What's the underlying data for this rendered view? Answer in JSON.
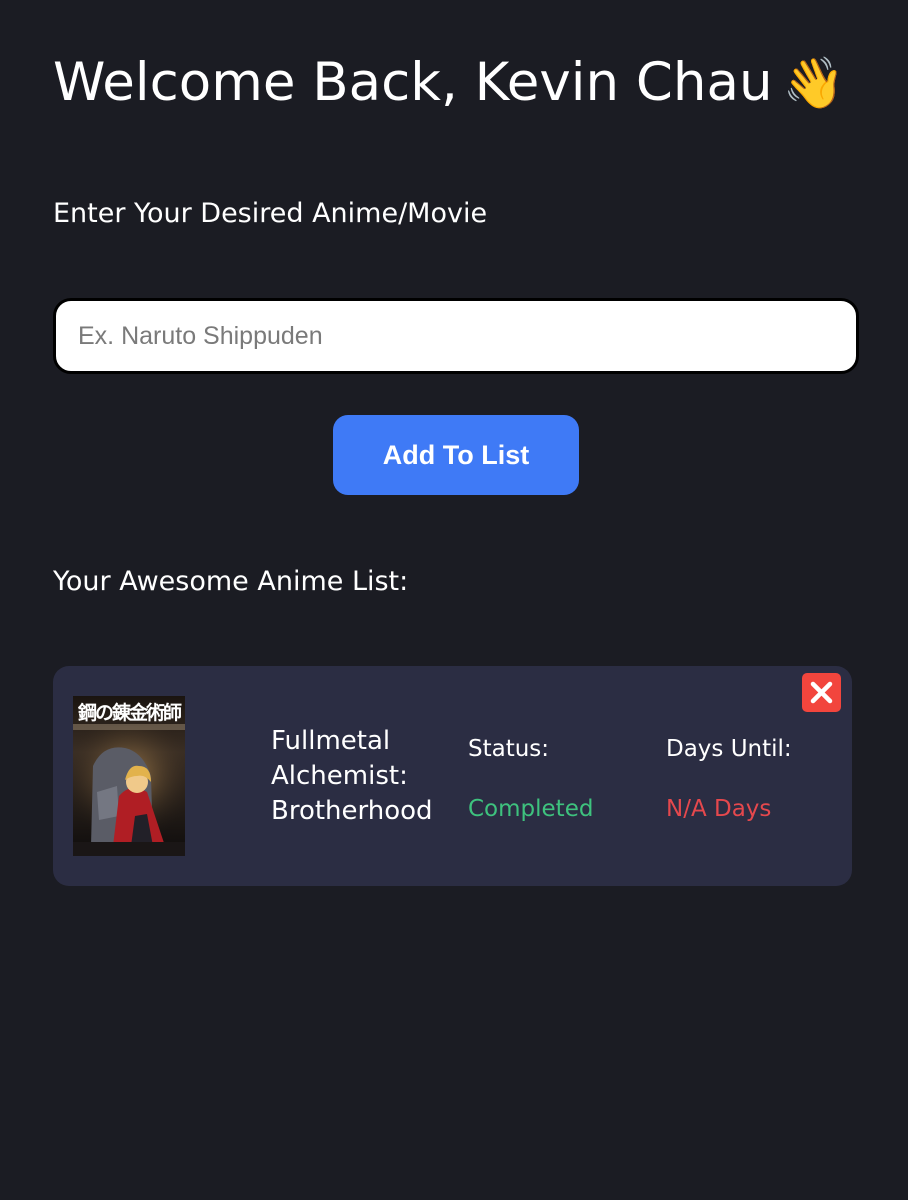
{
  "header": {
    "welcome_text": "Welcome Back, Kevin Chau",
    "wave_emoji": "👋"
  },
  "form": {
    "prompt_label": "Enter Your Desired Anime/Movie",
    "search_placeholder": "Ex. Naruto Shippuden",
    "search_value": "",
    "add_button_label": "Add To List"
  },
  "list": {
    "heading": "Your Awesome Anime List:",
    "items": [
      {
        "poster_text": "鋼の錬金術師",
        "title": "Fullmetal Alchemist: Brotherhood",
        "status_label": "Status:",
        "status_value": "Completed",
        "days_label": "Days Until:",
        "days_value": "N/A Days",
        "delete_icon": "close-x-icon"
      }
    ]
  },
  "colors": {
    "background": "#1b1c23",
    "card": "#2b2d43",
    "accent_button": "#3f7af6",
    "status_completed": "#3ec27e",
    "days_value": "#e5484d",
    "delete_button": "#f2453d"
  }
}
